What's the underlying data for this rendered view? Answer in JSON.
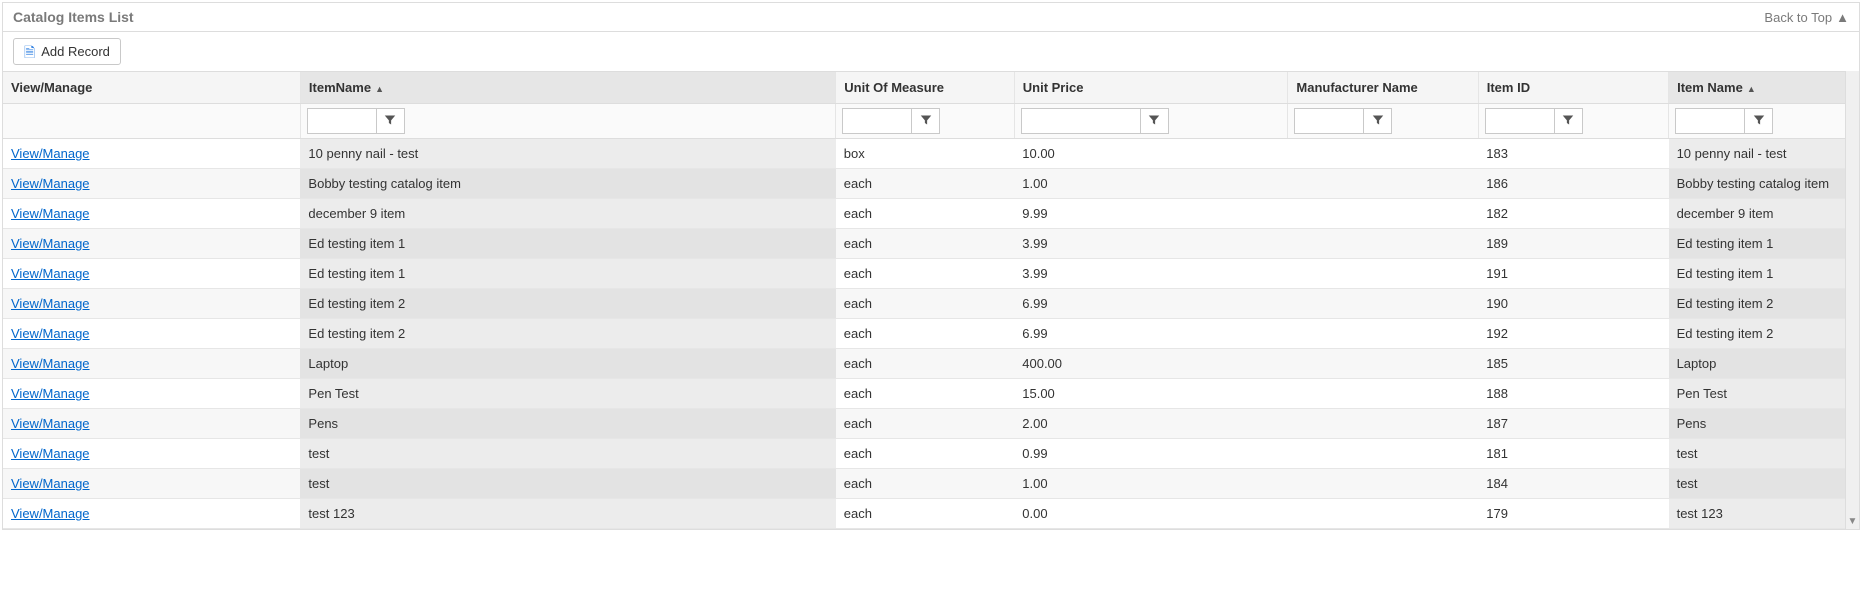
{
  "header": {
    "title": "Catalog Items List",
    "back_to_top": "Back to Top"
  },
  "toolbar": {
    "add_record": "Add Record"
  },
  "grid": {
    "columns": [
      {
        "label": "View/Manage",
        "filter": false,
        "sorted": false
      },
      {
        "label": "ItemName",
        "filter": true,
        "sorted": true
      },
      {
        "label": "Unit Of Measure",
        "filter": true,
        "sorted": false
      },
      {
        "label": "Unit Price",
        "filter": true,
        "sorted": false
      },
      {
        "label": "Manufacturer Name",
        "filter": true,
        "sorted": false
      },
      {
        "label": "Item ID",
        "filter": true,
        "sorted": false
      },
      {
        "label": "Item Name",
        "filter": true,
        "sorted": true
      }
    ],
    "link_label": "View/Manage",
    "rows": [
      {
        "item_name": "10 penny nail - test",
        "uom": "box",
        "price": "10.00",
        "mfr": "",
        "item_id": "183",
        "item_name2": "10 penny nail - test"
      },
      {
        "item_name": "Bobby testing catalog item",
        "uom": "each",
        "price": "1.00",
        "mfr": "",
        "item_id": "186",
        "item_name2": "Bobby testing catalog item"
      },
      {
        "item_name": "december 9 item",
        "uom": "each",
        "price": "9.99",
        "mfr": "",
        "item_id": "182",
        "item_name2": "december 9 item"
      },
      {
        "item_name": "Ed testing item 1",
        "uom": "each",
        "price": "3.99",
        "mfr": "",
        "item_id": "189",
        "item_name2": "Ed testing item 1"
      },
      {
        "item_name": "Ed testing item 1",
        "uom": "each",
        "price": "3.99",
        "mfr": "",
        "item_id": "191",
        "item_name2": "Ed testing item 1"
      },
      {
        "item_name": "Ed testing item 2",
        "uom": "each",
        "price": "6.99",
        "mfr": "",
        "item_id": "190",
        "item_name2": "Ed testing item 2"
      },
      {
        "item_name": "Ed testing item 2",
        "uom": "each",
        "price": "6.99",
        "mfr": "",
        "item_id": "192",
        "item_name2": "Ed testing item 2"
      },
      {
        "item_name": "Laptop",
        "uom": "each",
        "price": "400.00",
        "mfr": "",
        "item_id": "185",
        "item_name2": "Laptop"
      },
      {
        "item_name": "Pen Test",
        "uom": "each",
        "price": "15.00",
        "mfr": "",
        "item_id": "188",
        "item_name2": "Pen Test"
      },
      {
        "item_name": "Pens",
        "uom": "each",
        "price": "2.00",
        "mfr": "",
        "item_id": "187",
        "item_name2": "Pens"
      },
      {
        "item_name": "test",
        "uom": "each",
        "price": "0.99",
        "mfr": "",
        "item_id": "181",
        "item_name2": "test"
      },
      {
        "item_name": "test",
        "uom": "each",
        "price": "1.00",
        "mfr": "",
        "item_id": "184",
        "item_name2": "test"
      },
      {
        "item_name": "test 123",
        "uom": "each",
        "price": "0.00",
        "mfr": "",
        "item_id": "179",
        "item_name2": "test 123"
      }
    ]
  }
}
